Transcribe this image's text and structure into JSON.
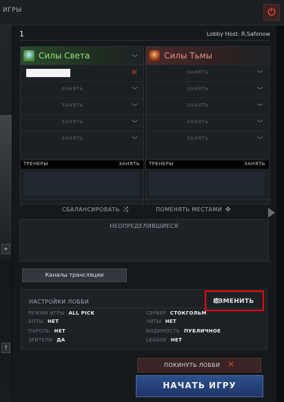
{
  "topbar": {
    "tab_label": "ИГРЫ",
    "power_icon": "power-icon"
  },
  "leftstrip": {
    "btn1": "+",
    "btn2": "?"
  },
  "lobby": {
    "name": "1",
    "host": "Lobby Host: R.Safonow"
  },
  "teams": {
    "radiant": {
      "name": "Силы Света",
      "slots": [
        "",
        "ЗАНЯТЬ",
        "ЗАНЯТЬ",
        "ЗАНЯТЬ",
        "ЗАНЯТЬ"
      ]
    },
    "dire": {
      "name": "Силы Тьмы",
      "slots": [
        "ЗАНЯТЬ",
        "ЗАНЯТЬ",
        "ЗАНЯТЬ",
        "ЗАНЯТЬ",
        "ЗАНЯТЬ"
      ]
    }
  },
  "coaches": {
    "label": "ТРЕНЕРЫ",
    "take": "ЗАНЯТЬ"
  },
  "actions": {
    "balance": "СБАЛАНСИРОВАТЬ",
    "swap": "ПОМЕНЯТЬ МЕСТАМИ"
  },
  "undecided": "НЕОПРЕДЕЛИВШИЕСЯ",
  "broadcast": "Каналы трансляции",
  "settings": {
    "title": "НАСТРОЙКИ ЛОББИ",
    "change": "ИЗМЕНИТЬ",
    "items": {
      "mode": {
        "k": "РЕЖИМ ИГРЫ",
        "v": "ALL PICK"
      },
      "bots": {
        "k": "БОТЫ",
        "v": "НЕТ"
      },
      "password": {
        "k": "ПАРОЛЬ",
        "v": "НЕТ"
      },
      "spectators": {
        "k": "ЗРИТЕЛИ",
        "v": "ДА"
      },
      "server": {
        "k": "СЕРВЕР",
        "v": "СТОКГОЛЬМ"
      },
      "cheats": {
        "k": "ЧИТЫ",
        "v": "НЕТ"
      },
      "visibility": {
        "k": "ВИДИМОСТЬ",
        "v": "ПУБЛИЧНОЕ"
      },
      "league": {
        "k": "LEAGUE",
        "v": "НЕТ"
      }
    }
  },
  "leave": "ПОКИНУТЬ ЛОББИ",
  "start": "НАЧАТЬ ИГРУ"
}
